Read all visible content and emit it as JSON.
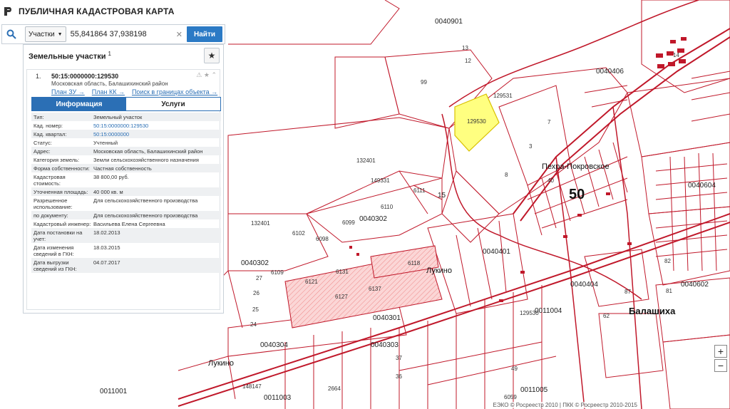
{
  "app": {
    "title": "ПУБЛИЧНАЯ КАДАСТРОВАЯ КАРТА"
  },
  "search": {
    "type_label": "Участки",
    "value": "55,841864 37,938198",
    "button_label": "Найти"
  },
  "panel": {
    "title": "Земельные участки",
    "count": "1",
    "result": {
      "index": "1.",
      "cad_number": "50:15:0000000:129530",
      "address": "Московская область, Балашихинский район",
      "links": [
        "План ЗУ →",
        "План КК →",
        "Поиск в границах объекта →"
      ]
    },
    "tabs": {
      "info": "Информация",
      "services": "Услуги"
    },
    "attributes": [
      {
        "label": "Тип:",
        "value": "Земельный участок"
      },
      {
        "label": "Кад. номер:",
        "value": "50:15:0000000:129530"
      },
      {
        "label": "Кад. квартал:",
        "value": "50:15:0000000"
      },
      {
        "label": "Статус:",
        "value": "Учтенный"
      },
      {
        "label": "Адрес:",
        "value": "Московская область, Балашихинский район"
      },
      {
        "label": "Категория земель:",
        "value": "Земли сельскохозяйственного назначения"
      },
      {
        "label": "Форма собственности:",
        "value": "Частная собственность"
      },
      {
        "label": "Кадастровая стоимость:",
        "value": "38 800,00 руб."
      },
      {
        "label": "Уточненная площадь:",
        "value": "40 000 кв. м"
      },
      {
        "label": "Разрешенное использование:",
        "value": "Для сельскохозяйственного производства"
      },
      {
        "label": "по документу:",
        "value": "Для сельскохозяйственного производства"
      },
      {
        "label": "Кадастровый инженер:",
        "value": "Васильева Елена Сергеевна"
      },
      {
        "label": "Дата постановки на учет:",
        "value": "18.02.2013"
      },
      {
        "label": "Дата изменения сведений в ГКН:",
        "value": "18.03.2015"
      },
      {
        "label": "Дата выгрузки сведений из ГКН:",
        "value": "04.07.2017"
      }
    ]
  },
  "map": {
    "labels": {
      "q40901": "0040901",
      "q40406": "0040406",
      "q40302a": "0040302",
      "q40302b": "0040302",
      "q40401": "0040401",
      "q40404": "0040404",
      "q40301": "0040301",
      "q40304": "0040304",
      "q40303": "0040303",
      "q11004": "0011004",
      "q11001": "0011001",
      "q11003": "0011003",
      "q11005": "0011005",
      "q40602": "0040602",
      "q40604": "0040604",
      "q40403": "0040403",
      "p129531": "129531",
      "p129530": "129530",
      "p132401a": "132401",
      "p132401b": "132401",
      "p149331": "149331",
      "p6111": "6111",
      "p6110": "6110",
      "p6099": "6099",
      "p6098": "6098",
      "p6102": "6102",
      "p6109": "6109",
      "p6118": "6118",
      "p6121": "6121",
      "p6131": "6131",
      "p6137": "6137",
      "p6127": "6127",
      "p6104": "6104",
      "p6119": "6119",
      "p148147": "148147",
      "p129530b": "129530",
      "p99": "99",
      "p7": "7",
      "p8": "8",
      "p3": "3",
      "p12": "12",
      "p13": "13",
      "p15": "15",
      "p24": "24",
      "p25": "25",
      "p26": "26",
      "p27": "27",
      "p40": "40",
      "p62": "62",
      "p87": "87",
      "p81": "81",
      "p82": "82",
      "p49": "49",
      "p37": "37",
      "p36": "36",
      "p2664": "2664",
      "p6059": "6059",
      "p14": "14",
      "n50": "50",
      "n15": "15",
      "pekhra": "Пехра-Покровское",
      "lukino1": "Лукино",
      "lukino2": "Лукино",
      "balashikha": "Балашиха"
    },
    "colors": {
      "boundary": "#c0182a",
      "selected_fill": "#ffff80",
      "selected_stroke": "#d8c000",
      "hatch": "#f2a0a0"
    },
    "credits": "ЕЭКО © Росреестр 2010 | ПКК © Росреестр 2010-2015"
  },
  "zoom": {
    "in": "+",
    "out": "−"
  }
}
